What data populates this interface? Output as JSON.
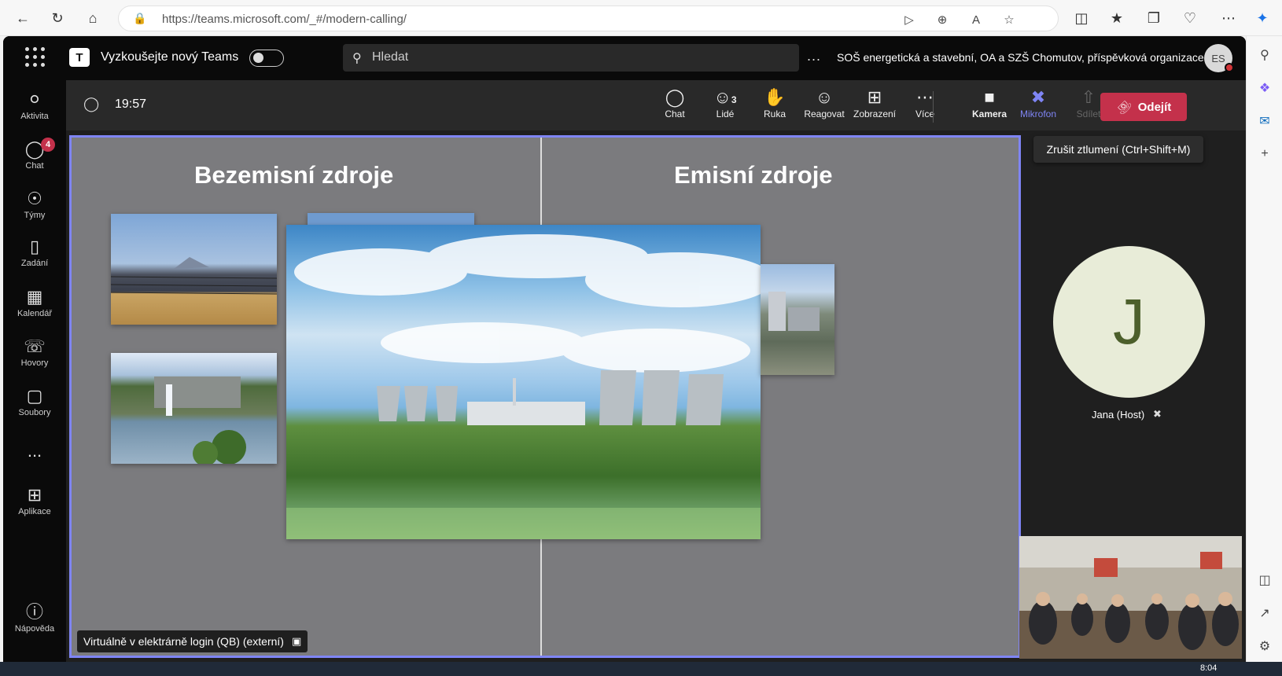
{
  "browser": {
    "url": "https://teams.microsoft.com/_#/modern-calling/"
  },
  "teams_header": {
    "new_teams_label": "Vyzkoušejte nový Teams",
    "search_placeholder": "Hledat",
    "more": "...",
    "org_name": "SOŠ energetická a stavební, OA a SZŠ Chomutov, příspěvková organizace",
    "avatar_initials": "ES"
  },
  "rail": {
    "items": [
      {
        "label": "Aktivita",
        "icon": "bell-icon"
      },
      {
        "label": "Chat",
        "icon": "chat-icon",
        "badge": "4"
      },
      {
        "label": "Týmy",
        "icon": "teams-icon"
      },
      {
        "label": "Zadání",
        "icon": "assignments-icon"
      },
      {
        "label": "Kalendář",
        "icon": "calendar-icon"
      },
      {
        "label": "Hovory",
        "icon": "phone-icon"
      },
      {
        "label": "Soubory",
        "icon": "file-icon"
      },
      {
        "label": "Aplikace",
        "icon": "apps-icon"
      },
      {
        "label": "Nápověda",
        "icon": "help-icon"
      }
    ],
    "more": "..."
  },
  "meeting_bar": {
    "timer": "19:57",
    "buttons": {
      "chat": "Chat",
      "people": "Lidé",
      "people_count": "3",
      "hand": "Ruka",
      "react": "Reagovat",
      "view": "Zobrazení",
      "more": "Více",
      "camera": "Kamera",
      "mic": "Mikrofon",
      "share": "Sdílet"
    },
    "leave": "Odejít"
  },
  "stage": {
    "left_heading": "Bezemisní zdroje",
    "right_heading": "Emisní zdroje",
    "presenter_label": "Virtuálně v elektrárně login (QB) (externí)"
  },
  "right_panel": {
    "tooltip": "Zrušit ztlumení (Ctrl+Shift+M)",
    "participant_initial": "J",
    "participant_name": "Jana (Host)"
  },
  "taskbar": {
    "time": "8:04"
  },
  "colors": {
    "accent": "#7f85f5",
    "leave": "#c4314b",
    "badge": "#c4314b"
  }
}
